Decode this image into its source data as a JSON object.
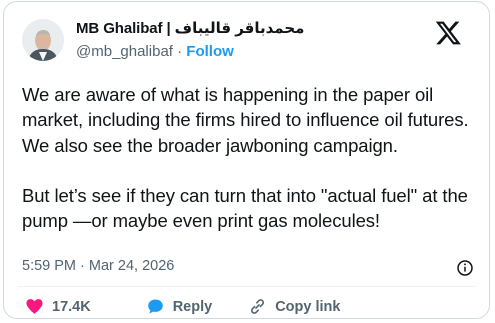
{
  "header": {
    "display_name": "MB Ghalibaf | محمدباقر قالیباف",
    "handle": "@mb_ghalibaf",
    "separator": "·",
    "follow_label": "Follow"
  },
  "post": {
    "paragraphs": [
      "We are aware of what is happening in the paper oil market, including the firms hired to influence oil futures. We also see the broader jawboning campaign.",
      "But let’s see if they can turn that into \"actual fuel\" at the pump —or maybe even print gas molecules!"
    ],
    "timestamp": "5:59 PM · Mar 24, 2026"
  },
  "actions": {
    "like_count": "17.4K",
    "reply_label": "Reply",
    "copy_link_label": "Copy link"
  },
  "icons": {
    "logo": "x-logo-icon",
    "info": "info-icon",
    "like": "heart-icon",
    "reply": "reply-bubble-icon",
    "copy": "link-icon"
  },
  "colors": {
    "accent": "#1d9bf0",
    "like": "#f91880",
    "text": "#0f1419",
    "secondary": "#536471",
    "border": "#cfd9de"
  }
}
